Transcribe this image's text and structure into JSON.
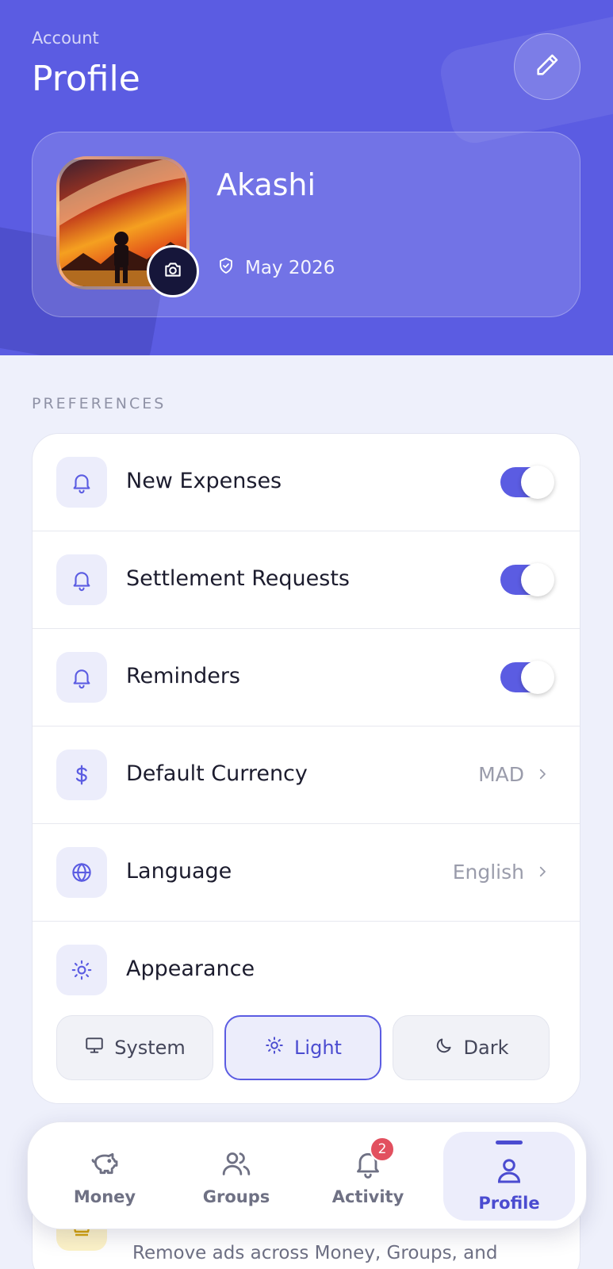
{
  "header": {
    "eyebrow": "Account",
    "title": "Profile",
    "edit_icon": "pencil-icon"
  },
  "profile": {
    "name": "Akashi",
    "member_since": "May 2026",
    "camera_icon": "camera-icon",
    "badge_icon": "shield-check-icon"
  },
  "preferences": {
    "section_label": "PREFERENCES",
    "items": [
      {
        "label": "New Expenses",
        "icon": "bell-icon",
        "type": "toggle",
        "on": true
      },
      {
        "label": "Settlement Requests",
        "icon": "bell-icon",
        "type": "toggle",
        "on": true
      },
      {
        "label": "Reminders",
        "icon": "bell-icon",
        "type": "toggle",
        "on": true
      },
      {
        "label": "Default Currency",
        "icon": "dollar-icon",
        "type": "link",
        "value": "MAD"
      },
      {
        "label": "Language",
        "icon": "globe-icon",
        "type": "link",
        "value": "English"
      }
    ],
    "appearance": {
      "label": "Appearance",
      "icon": "sun-icon",
      "options": [
        "System",
        "Light",
        "Dark"
      ],
      "selected": "Light"
    }
  },
  "premium": {
    "subtitle": "Remove ads across Money, Groups, and",
    "icon": "crown-icon"
  },
  "nav": {
    "items": [
      {
        "label": "Money",
        "icon": "piggy-bank-icon"
      },
      {
        "label": "Groups",
        "icon": "users-icon"
      },
      {
        "label": "Activity",
        "icon": "bell-icon",
        "badge": "2"
      },
      {
        "label": "Profile",
        "icon": "user-icon"
      }
    ],
    "active": "Profile"
  },
  "colors": {
    "accent": "#5b5ce2",
    "badge": "#e2505f",
    "header_bg": "#5b5ce2"
  }
}
